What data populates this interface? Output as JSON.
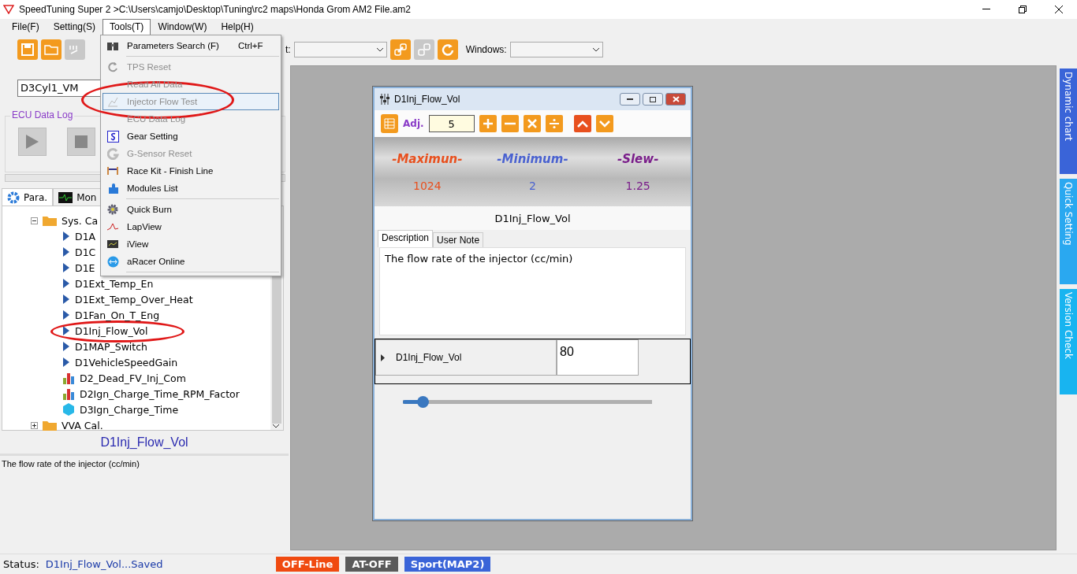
{
  "window": {
    "title": "SpeedTuning Super 2  >C:\\Users\\camjo\\Desktop\\Tuning\\rc2 maps\\Honda Grom AM2 File.am2"
  },
  "menu_bar": [
    {
      "label": "File(F)",
      "selected": false
    },
    {
      "label": "Setting(S)",
      "selected": false
    },
    {
      "label": "Tools(T)",
      "selected": true
    },
    {
      "label": "Window(W)",
      "selected": false
    },
    {
      "label": "Help(H)",
      "selected": false
    }
  ],
  "toolbar": {
    "port_label": "t:",
    "windows_label": "Windows:"
  },
  "parameter_combo": {
    "value": "D3Cyl1_VM"
  },
  "ecu_data_log": {
    "title": "ECU Data Log"
  },
  "panel_tabs": [
    {
      "label": "Para.",
      "selected": true
    },
    {
      "label": "Mon",
      "selected": false
    }
  ],
  "tree": [
    {
      "label": "Sys. Ca",
      "kind": "folder",
      "expanded": true,
      "children": [
        {
          "label": "D1A",
          "kind": "param"
        },
        {
          "label": "D1C",
          "kind": "param"
        },
        {
          "label": "D1E",
          "kind": "param"
        },
        {
          "label": "D1Ext_Temp_En",
          "kind": "param"
        },
        {
          "label": "D1Ext_Temp_Over_Heat",
          "kind": "param"
        },
        {
          "label": "D1Fan_On_T_Eng",
          "kind": "param"
        },
        {
          "label": "D1Inj_Flow_Vol",
          "kind": "param"
        },
        {
          "label": "D1MAP_Switch",
          "kind": "param"
        },
        {
          "label": "D1VehicleSpeedGain",
          "kind": "param"
        },
        {
          "label": "D2_Dead_FV_Inj_Com",
          "kind": "table"
        },
        {
          "label": "D2Ign_Charge_Time_RPM_Factor",
          "kind": "table"
        },
        {
          "label": "D3Ign_Charge_Time",
          "kind": "map"
        }
      ]
    },
    {
      "label": "VVA Cal.",
      "kind": "folder",
      "expanded": false
    }
  ],
  "selected_parameter": "D1Inj_Flow_Vol",
  "parameter_description": "The flow rate of the injector (cc/min)",
  "tools_menu": [
    {
      "kind": "item",
      "label": "Parameters Search (F)",
      "shortcut": "Ctrl+F",
      "disabled": false,
      "selected": false
    },
    {
      "kind": "separator"
    },
    {
      "kind": "item",
      "label": "TPS Reset",
      "disabled": true,
      "selected": false
    },
    {
      "kind": "item",
      "label": "Read All Data",
      "disabled": true,
      "selected": false
    },
    {
      "kind": "item",
      "label": "Injector Flow Test",
      "disabled": true,
      "selected": true
    },
    {
      "kind": "item",
      "label": "ECU Data Log",
      "disabled": true,
      "selected": false
    },
    {
      "kind": "item",
      "label": "Gear Setting",
      "disabled": false,
      "selected": false
    },
    {
      "kind": "item",
      "label": "G-Sensor Reset",
      "disabled": true,
      "selected": false
    },
    {
      "kind": "item",
      "label": "Race Kit - Finish Line",
      "disabled": false,
      "selected": false
    },
    {
      "kind": "item",
      "label": "Modules List",
      "disabled": false,
      "selected": false
    },
    {
      "kind": "separator"
    },
    {
      "kind": "item",
      "label": "Quick Burn",
      "disabled": false,
      "selected": false
    },
    {
      "kind": "item",
      "label": "LapView",
      "disabled": false,
      "selected": false
    },
    {
      "kind": "item",
      "label": "iView",
      "disabled": false,
      "selected": false
    },
    {
      "kind": "item",
      "label": "aRacer Online",
      "disabled": false,
      "selected": false
    },
    {
      "kind": "separator"
    }
  ],
  "editor_window": {
    "title": "D1Inj_Flow_Vol",
    "adj_label": "Adj.",
    "adj_value": "5",
    "limits": [
      {
        "label": "-Maximun-",
        "value": "1024",
        "color": "#e8501e"
      },
      {
        "label": "-Minimum-",
        "value": "2",
        "color": "#4a62d0"
      },
      {
        "label": "-Slew-",
        "value": "1.25",
        "color": "#7a1e8a"
      }
    ],
    "parameter_name": "D1Inj_Flow_Vol",
    "tabs": [
      {
        "label": "Description",
        "selected": true
      },
      {
        "label": "User Note",
        "selected": false
      }
    ],
    "description": "The flow rate of the injector (cc/min)",
    "row": {
      "name": "D1Inj_Flow_Vol",
      "value": "80"
    },
    "slider": {
      "level": 0.08
    }
  },
  "side_tabs": [
    {
      "label": "Dynamic chart",
      "color": "#3a64d8"
    },
    {
      "label": "Quick Setting",
      "color": "#2aa8f0"
    },
    {
      "label": "Version Check",
      "color": "#18b4f0"
    }
  ],
  "status_bar": {
    "label": "Status:",
    "message": "D1Inj_Flow_Vol...Saved",
    "badges": [
      {
        "label": "OFF-Line",
        "color": "#f04a10"
      },
      {
        "label": "AT-OFF",
        "color": "#5a5a5a"
      },
      {
        "label": "Sport(MAP2)",
        "color": "#3a64d8"
      }
    ]
  },
  "annotations": [
    {
      "kind": "oval"
    },
    {
      "kind": "oval"
    }
  ]
}
